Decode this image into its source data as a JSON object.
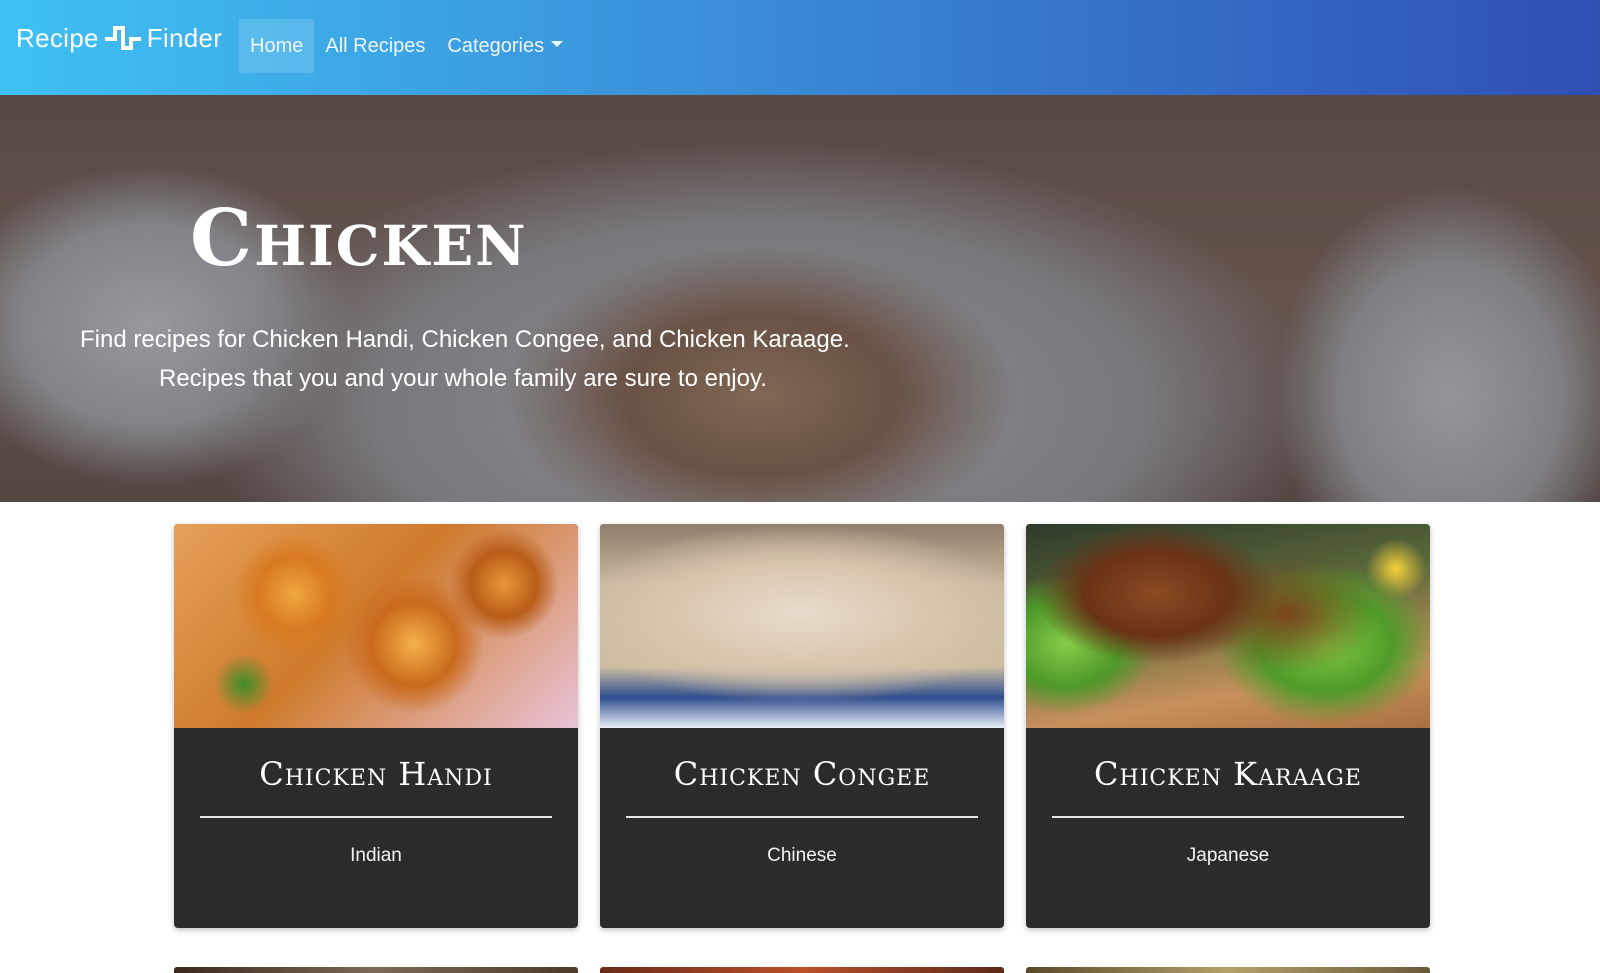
{
  "navbar": {
    "brand_left": "Recipe",
    "brand_right": "Finder",
    "logo_icon": "pulse-step-icon",
    "links": [
      {
        "label": "Home",
        "active": true
      },
      {
        "label": "All Recipes",
        "active": false
      },
      {
        "label": "Categories",
        "active": false,
        "dropdown": true
      }
    ],
    "gradient_colors": [
      "#3fc1f3",
      "#2f4fb3"
    ]
  },
  "hero": {
    "title": "Chicken",
    "text_line1": "Find recipes for Chicken Handi, Chicken Congee, and Chicken Karaage.",
    "text_line2": "Recipes that you and your whole family are sure to enjoy.",
    "image": "roast-chicken-photo"
  },
  "cards": [
    {
      "title": "Chicken Handi",
      "category": "Indian",
      "image": "chicken-handi-photo"
    },
    {
      "title": "Chicken Congee",
      "category": "Chinese",
      "image": "chicken-congee-photo"
    },
    {
      "title": "Chicken Karaage",
      "category": "Japanese",
      "image": "chicken-karaage-photo"
    }
  ],
  "colors": {
    "card_background": "#2b2b2c",
    "card_text": "#ffffff"
  }
}
